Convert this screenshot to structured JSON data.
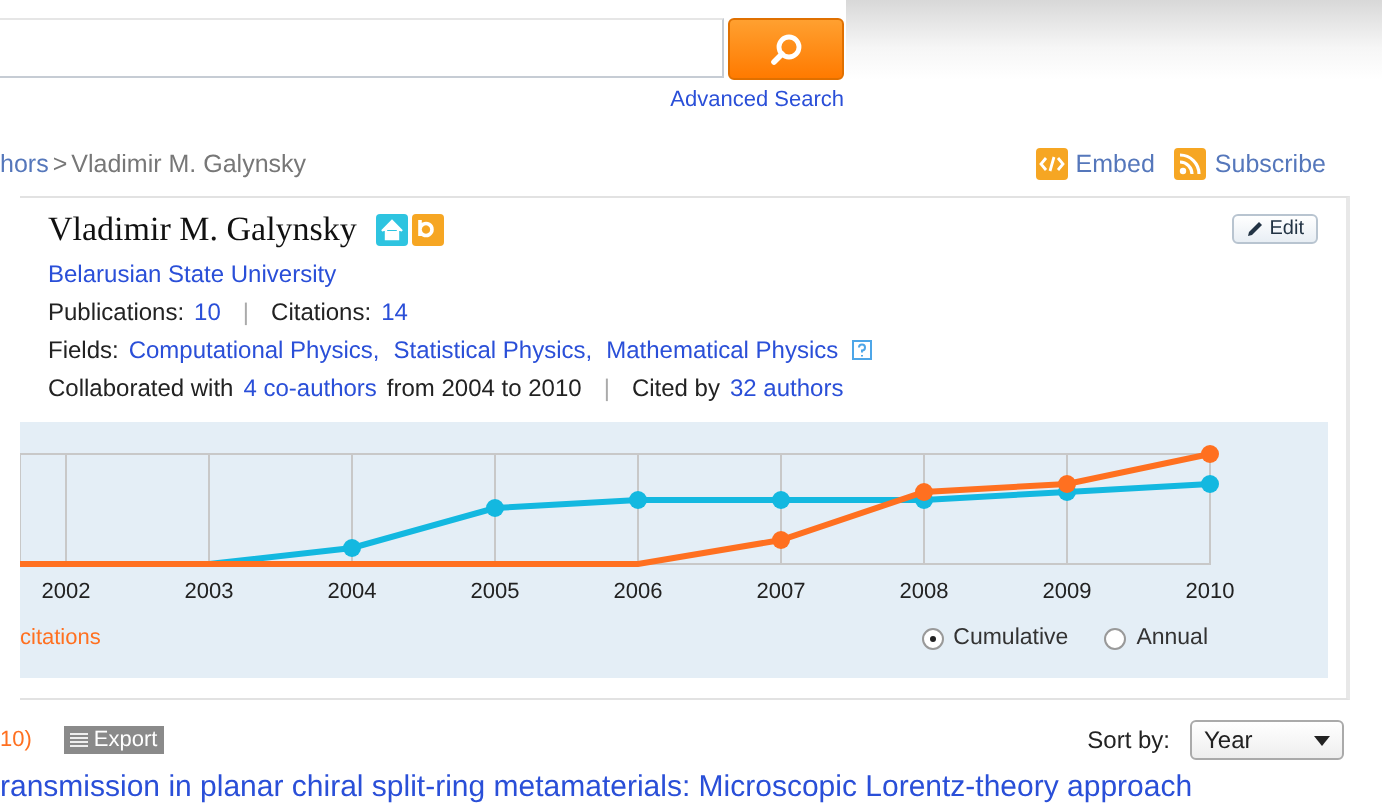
{
  "search": {
    "advanced_link": "Advanced Search"
  },
  "breadcrumb": {
    "parent": "hors",
    "separator": ">",
    "current": "Vladimir M. Galynsky"
  },
  "actions": [
    {
      "kind": "embed",
      "label": "Embed"
    },
    {
      "kind": "subscribe",
      "label": "Subscribe"
    }
  ],
  "profile": {
    "name": "Vladimir M. Galynsky",
    "edit": "Edit",
    "affiliation": "Belarusian State University",
    "publications_label": "Publications:",
    "publications": "10",
    "separator": "|",
    "citations_label": "Citations:",
    "citations": "14",
    "fields_label": "Fields:",
    "fields": [
      "Computational Physics,",
      "Statistical Physics,",
      "Mathematical Physics"
    ],
    "collab_prefix": "Collaborated with",
    "coauthors": "4 co-authors",
    "collab_suffix": "from 2004 to 2010",
    "cited_prefix": "Cited by",
    "cited": "32 authors"
  },
  "chart": {
    "years": [
      "2002",
      "2003",
      "2004",
      "2005",
      "2006",
      "2007",
      "2008",
      "2009",
      "2010"
    ],
    "legend": "citations",
    "modes": [
      {
        "label": "Cumulative",
        "selected": true
      },
      {
        "label": "Annual",
        "selected": false
      }
    ]
  },
  "results": {
    "count": "10)",
    "export": "Export",
    "sort_label": "Sort by:",
    "sort_value": "Year",
    "first_title": "ransmission in planar chiral split-ring metamaterials: Microscopic Lorentz-theory approach"
  }
}
